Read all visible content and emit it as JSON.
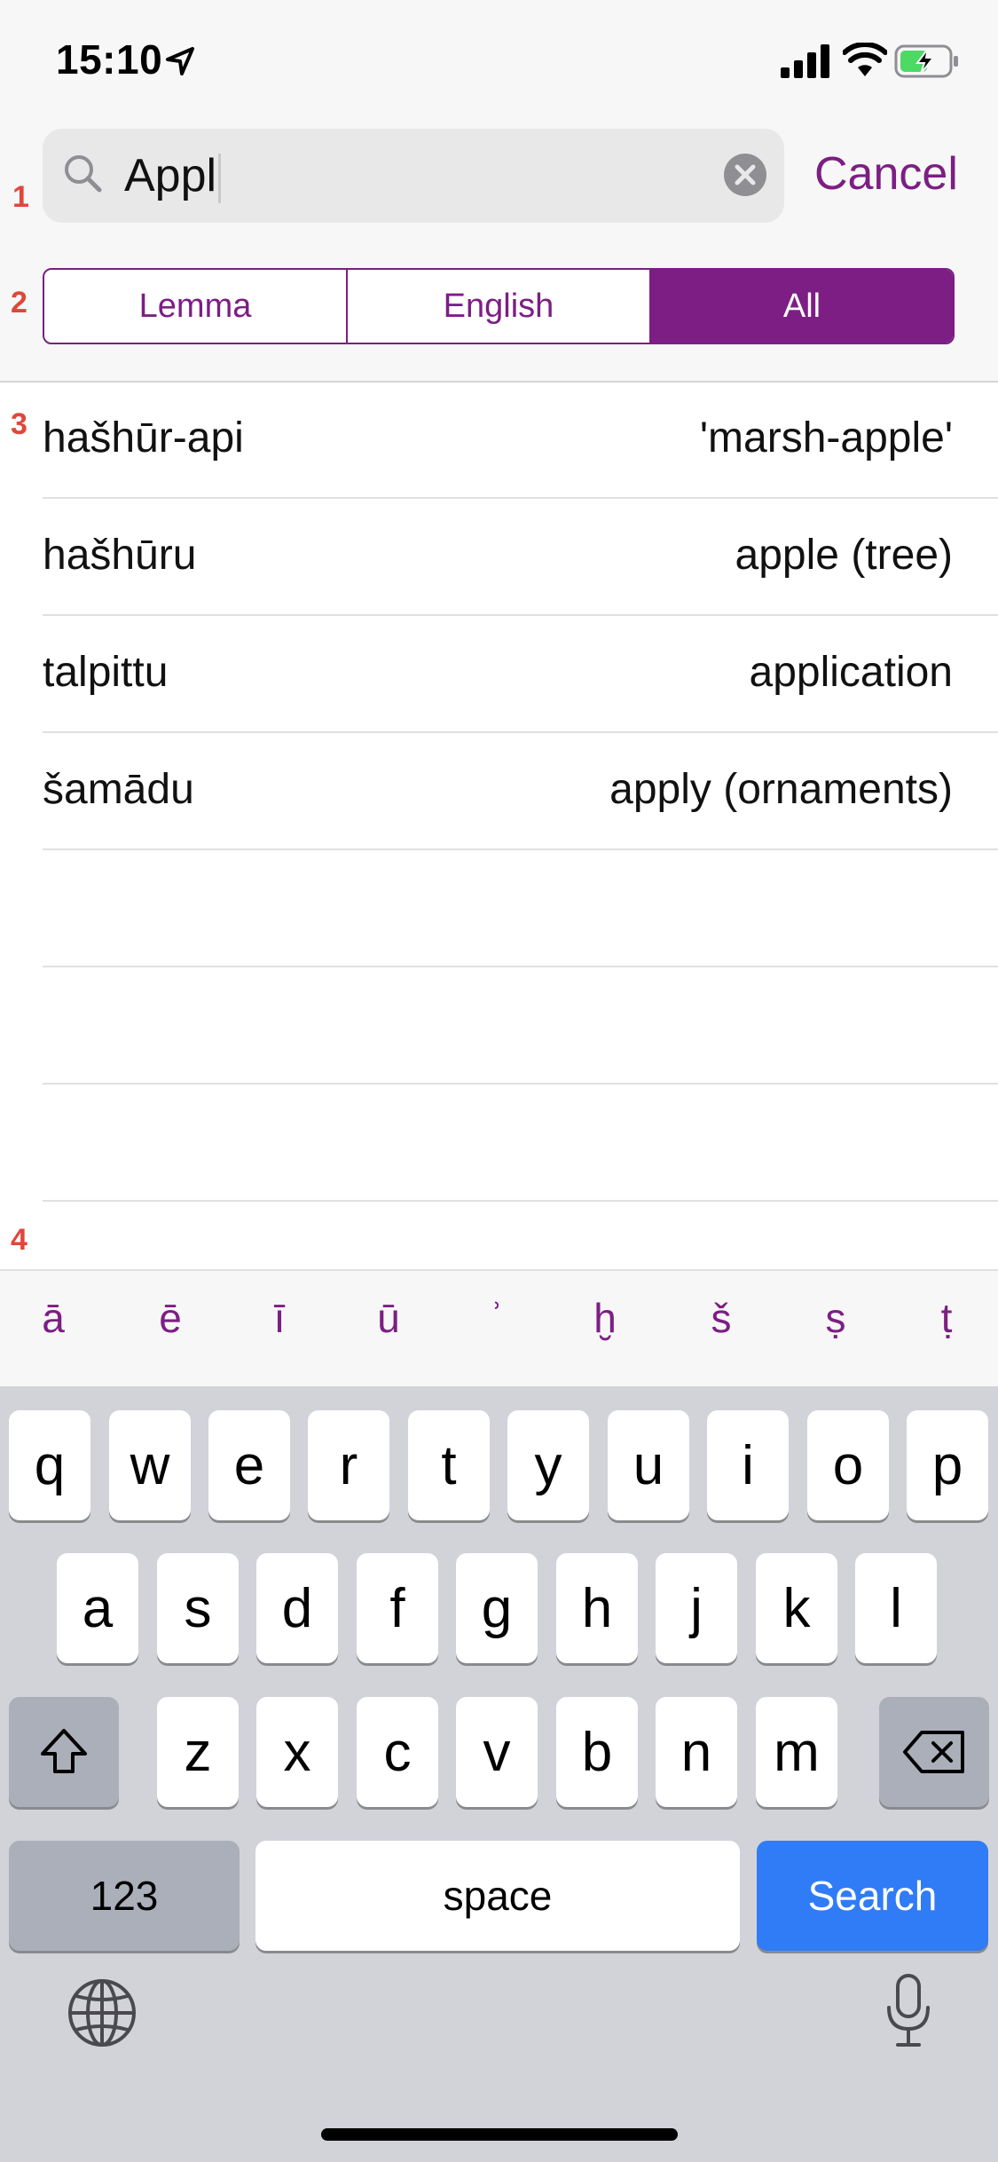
{
  "status_bar": {
    "time": "15:10"
  },
  "search": {
    "query": "Appl",
    "cancel_label": "Cancel"
  },
  "segments": [
    {
      "label": "Lemma",
      "selected": false
    },
    {
      "label": "English",
      "selected": false
    },
    {
      "label": "All",
      "selected": true
    }
  ],
  "markers": [
    "1",
    "2",
    "3",
    "4"
  ],
  "results": [
    {
      "lemma": "hašhūr-api",
      "gloss": "'marsh-apple'"
    },
    {
      "lemma": "hašhūru",
      "gloss": "apple (tree)"
    },
    {
      "lemma": "talpittu",
      "gloss": "application"
    },
    {
      "lemma": "šamādu",
      "gloss": "apply (ornaments)"
    }
  ],
  "diacritics": [
    "ā",
    "ē",
    "ī",
    "ū",
    "ʾ",
    "ḫ",
    "š",
    "ṣ",
    "ṭ"
  ],
  "keyboard": {
    "row1": [
      "q",
      "w",
      "e",
      "r",
      "t",
      "y",
      "u",
      "i",
      "o",
      "p"
    ],
    "row2": [
      "a",
      "s",
      "d",
      "f",
      "g",
      "h",
      "j",
      "k",
      "l"
    ],
    "row3": [
      "z",
      "x",
      "c",
      "v",
      "b",
      "n",
      "m"
    ],
    "numbers_label": "123",
    "space_label": "space",
    "search_label": "Search"
  },
  "colors": {
    "accent": "#7c1e84",
    "search_key": "#2f7cf6"
  }
}
